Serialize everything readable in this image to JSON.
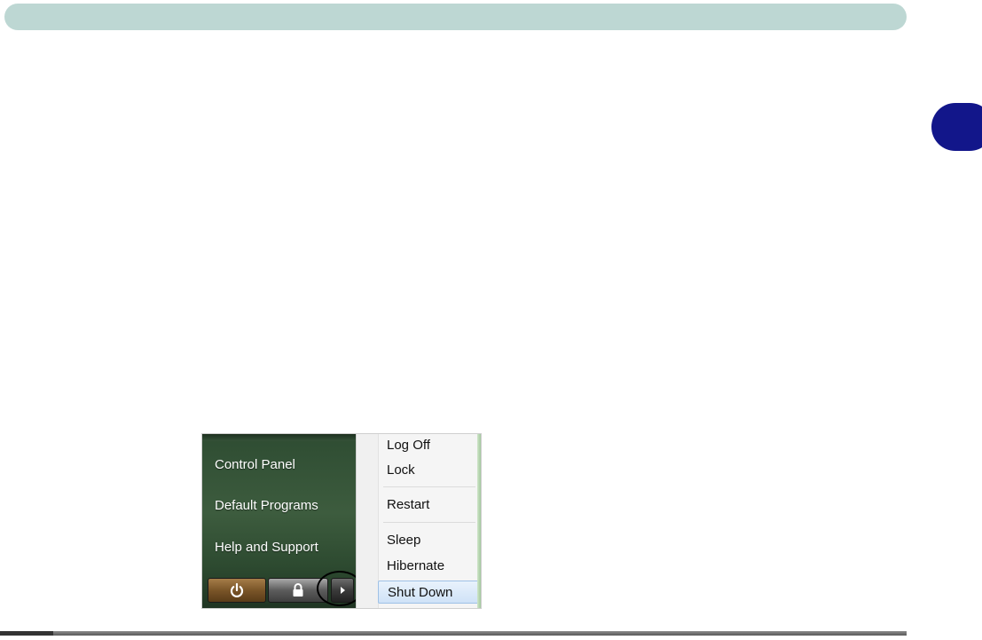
{
  "start_menu": {
    "left_items": [
      "Control Panel",
      "Default Programs",
      "Help and Support"
    ]
  },
  "power_menu": {
    "items": [
      "Log Off",
      "Lock",
      "Restart",
      "Sleep",
      "Hibernate",
      "Shut Down"
    ],
    "selected": "Shut Down"
  },
  "colors": {
    "header_bar": "#bdd7d3",
    "chapter_tab": "#12168a",
    "menu_highlight": "#cfe2f7"
  }
}
